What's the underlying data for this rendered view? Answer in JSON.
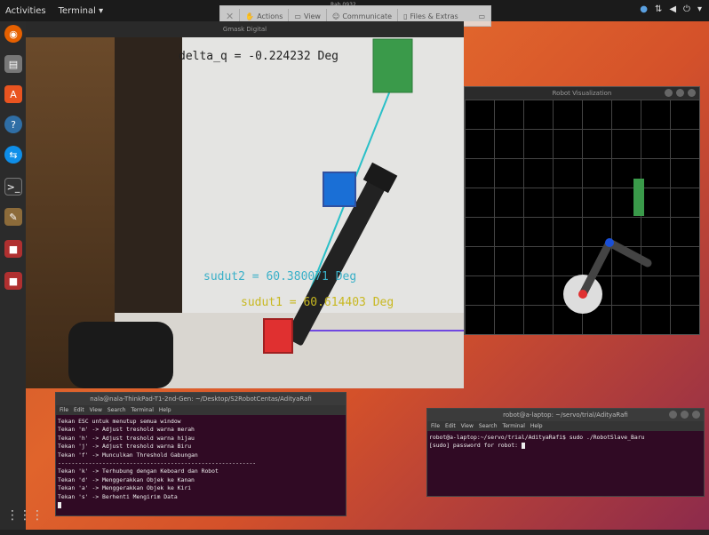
{
  "topbar": {
    "activities": "Activities",
    "app_menu": "Terminal ▾"
  },
  "remote_toolbar": {
    "close_label": "✕",
    "actions": "Actions",
    "view": "View",
    "communicate": "Communicate",
    "files": "Files & Extras",
    "connection_label": "Rab 0932"
  },
  "dock": {
    "items": [
      {
        "name": "firefox",
        "color": "#e66000"
      },
      {
        "name": "files",
        "color": "#666"
      },
      {
        "name": "software",
        "color": "#e95420"
      },
      {
        "name": "help",
        "color": "#2f6ea5"
      },
      {
        "name": "teamviewer",
        "color": "#0e8ee9"
      },
      {
        "name": "terminal",
        "color": "#333"
      },
      {
        "name": "gimp",
        "color": "#8c6b3a"
      },
      {
        "name": "app-red-1",
        "color": "#b03030"
      },
      {
        "name": "app-red-2",
        "color": "#b03030"
      }
    ]
  },
  "camera_window": {
    "title": "Gmask Digital",
    "delta_q": "delta_q = -0.224232 Deg",
    "sudut2": "sudut2 = 60.380071 Deg",
    "sudut1": "sudut1 = 60.614403 Deg"
  },
  "robot_window": {
    "title": "Robot Visualization"
  },
  "terminal1": {
    "title": "nala@nala-ThinkPad-T1-2nd-Gen: ~/Desktop/S2RobotCentas/AdityaRafi",
    "menu": [
      "File",
      "Edit",
      "View",
      "Search",
      "Terminal",
      "Help"
    ],
    "lines": [
      "Tekan ESC untuk menutup semua window",
      "Tekan 'm' -> Adjust treshold warna merah",
      "Tekan 'h' -> Adjust treshold warna hijau",
      "Tekan 'j' -> Adjust treshold warna Biru",
      "Tekan 'f' -> Munculkan Threshold Gabungan",
      "----------------------------------------------------------",
      "Tekan 'k' -> Terhubung dengan Keboard dan Robot",
      "Tekan 'd' -> Menggerakkan Objek ke Kanan",
      "Tekan 'a' -> Menggerakkan Objek ke Kiri",
      "Tekan 's' -> Berhenti Mengirim Data"
    ]
  },
  "terminal2": {
    "title": "robot@a-laptop: ~/servo/trial/AdityaRafi",
    "menu": [
      "File",
      "Edit",
      "View",
      "Search",
      "Terminal",
      "Help"
    ],
    "lines": [
      "robot@a-laptop:~/servo/trial/AdityaRafi$ sudo ./RobotSlave_Baru",
      "[sudo] password for robot: "
    ]
  },
  "colors": {
    "cam_green_box": "#3a9a4a",
    "cam_blue_box": "#1a6fd6",
    "cam_red_box": "#e03030",
    "cam_text_yellow": "#c8b820",
    "cam_text_cyan": "#3ab0c8",
    "laser_cyan": "#2ac0c8",
    "robot_arm": "#444"
  }
}
